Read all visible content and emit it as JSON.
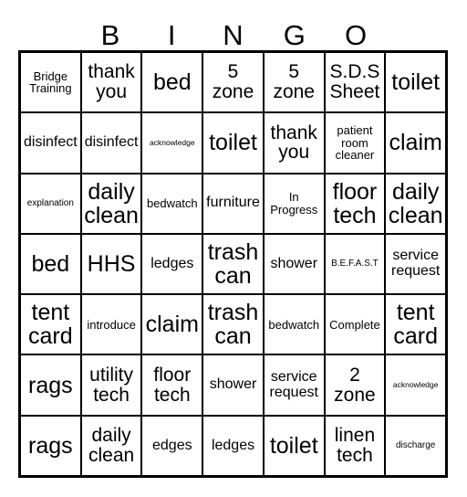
{
  "card": {
    "header_letters": [
      "",
      "B",
      "I",
      "N",
      "G",
      "O",
      ""
    ],
    "columns": 7,
    "rows": 7,
    "colors": {
      "ink": "#000000",
      "paper": "#ffffff",
      "grid_line": "#000000"
    },
    "cells": [
      [
        {
          "text": "Bridge Training",
          "size": "sm"
        },
        {
          "text": "thank you",
          "size": "lg"
        },
        {
          "text": "bed",
          "size": "xl"
        },
        {
          "text": "5 zone",
          "size": "lg"
        },
        {
          "text": "5 zone",
          "size": "lg"
        },
        {
          "text": "S.D.S Sheet",
          "size": "lg"
        },
        {
          "text": "toilet",
          "size": "xl"
        }
      ],
      [
        {
          "text": "disinfect",
          "size": "md"
        },
        {
          "text": "disinfect",
          "size": "md"
        },
        {
          "text": "acknowledge",
          "size": "xxs"
        },
        {
          "text": "toilet",
          "size": "xl"
        },
        {
          "text": "thank you",
          "size": "lg"
        },
        {
          "text": "patient room cleaner",
          "size": "sm"
        },
        {
          "text": "claim",
          "size": "xl"
        }
      ],
      [
        {
          "text": "explanation",
          "size": "xs"
        },
        {
          "text": "daily clean",
          "size": "xl"
        },
        {
          "text": "bedwatch",
          "size": "sm"
        },
        {
          "text": "furniture",
          "size": "md"
        },
        {
          "text": "In Progress",
          "size": "sm"
        },
        {
          "text": "floor tech",
          "size": "xl"
        },
        {
          "text": "daily clean",
          "size": "xl"
        }
      ],
      [
        {
          "text": "bed",
          "size": "xl"
        },
        {
          "text": "HHS",
          "size": "xl"
        },
        {
          "text": "ledges",
          "size": "md"
        },
        {
          "text": "trash can",
          "size": "xl"
        },
        {
          "text": "shower",
          "size": "md"
        },
        {
          "text": "B.E.F.A.S.T",
          "size": "xs"
        },
        {
          "text": "service request",
          "size": "md"
        }
      ],
      [
        {
          "text": "tent card",
          "size": "xl"
        },
        {
          "text": "introduce",
          "size": "sm"
        },
        {
          "text": "claim",
          "size": "xl"
        },
        {
          "text": "trash can",
          "size": "xl"
        },
        {
          "text": "bedwatch",
          "size": "sm"
        },
        {
          "text": "Complete",
          "size": "sm"
        },
        {
          "text": "tent card",
          "size": "xl"
        }
      ],
      [
        {
          "text": "rags",
          "size": "xl"
        },
        {
          "text": "utility tech",
          "size": "lg"
        },
        {
          "text": "floor tech",
          "size": "lg"
        },
        {
          "text": "shower",
          "size": "md"
        },
        {
          "text": "service request",
          "size": "md"
        },
        {
          "text": "2 zone",
          "size": "lg"
        },
        {
          "text": "acknowledge",
          "size": "xxs"
        }
      ],
      [
        {
          "text": "rags",
          "size": "xl"
        },
        {
          "text": "daily clean",
          "size": "lg"
        },
        {
          "text": "edges",
          "size": "md"
        },
        {
          "text": "ledges",
          "size": "md"
        },
        {
          "text": "toilet",
          "size": "xl"
        },
        {
          "text": "linen tech",
          "size": "lg"
        },
        {
          "text": "discharge",
          "size": "xs"
        }
      ]
    ]
  }
}
